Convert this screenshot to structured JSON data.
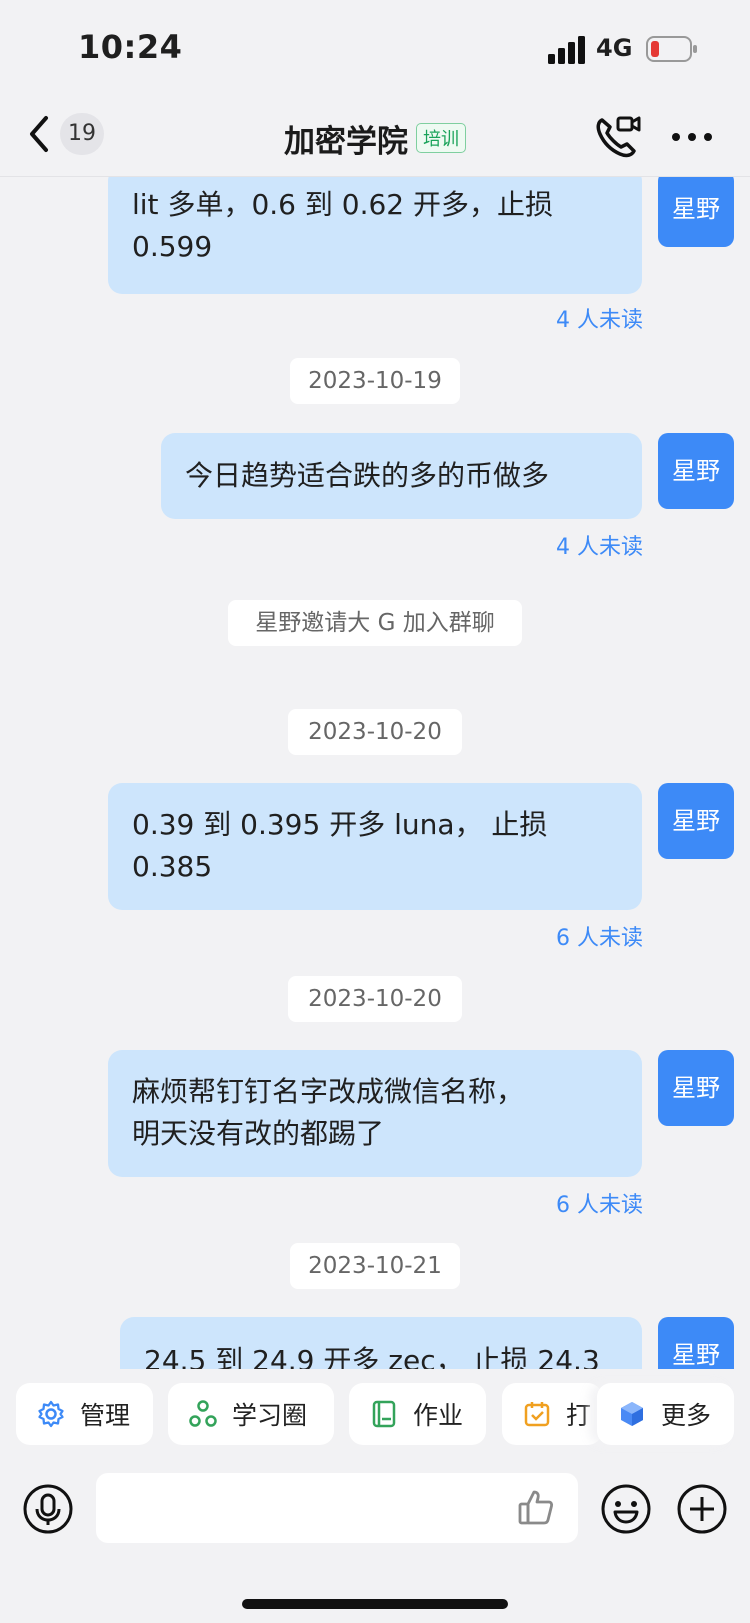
{
  "status_bar": {
    "time": "10:24",
    "network": "4G"
  },
  "header": {
    "back_count": "19",
    "title": "加密学院",
    "tag": "培训"
  },
  "messages": [
    {
      "lines": [
        "lit 多单，0.6 到 0.62 开多，止损",
        "0.599"
      ],
      "sender": "星野",
      "unread": "4 人未读"
    },
    {
      "date": "2023-10-19"
    },
    {
      "lines": [
        "今日趋势适合跌的多的币做多"
      ],
      "sender": "星野",
      "unread": "4 人未读"
    },
    {
      "system": "星野邀请大 G 加入群聊"
    },
    {
      "date": "2023-10-20"
    },
    {
      "lines": [
        "0.39 到 0.395 开多 luna， 止损",
        "0.385"
      ],
      "sender": "星野",
      "unread": "6 人未读"
    },
    {
      "date": "2023-10-20"
    },
    {
      "lines": [
        "麻烦帮钉钉名字改成微信名称，",
        "明天没有改的都踢了"
      ],
      "sender": "星野",
      "unread": "6 人未读"
    },
    {
      "date": "2023-10-21"
    },
    {
      "lines": [
        "24.5 到 24.9 开多 zec， 止损 24.3"
      ],
      "sender": "星野"
    }
  ],
  "quick_actions": [
    "管理",
    "学习圈",
    "作业",
    "打",
    "更多"
  ],
  "input": {
    "placeholder": ""
  },
  "colors": {
    "accent": "#3d8af7",
    "bubble": "#cde5fc",
    "background": "#f2f2f4",
    "tag_green": "#1aa35a"
  }
}
